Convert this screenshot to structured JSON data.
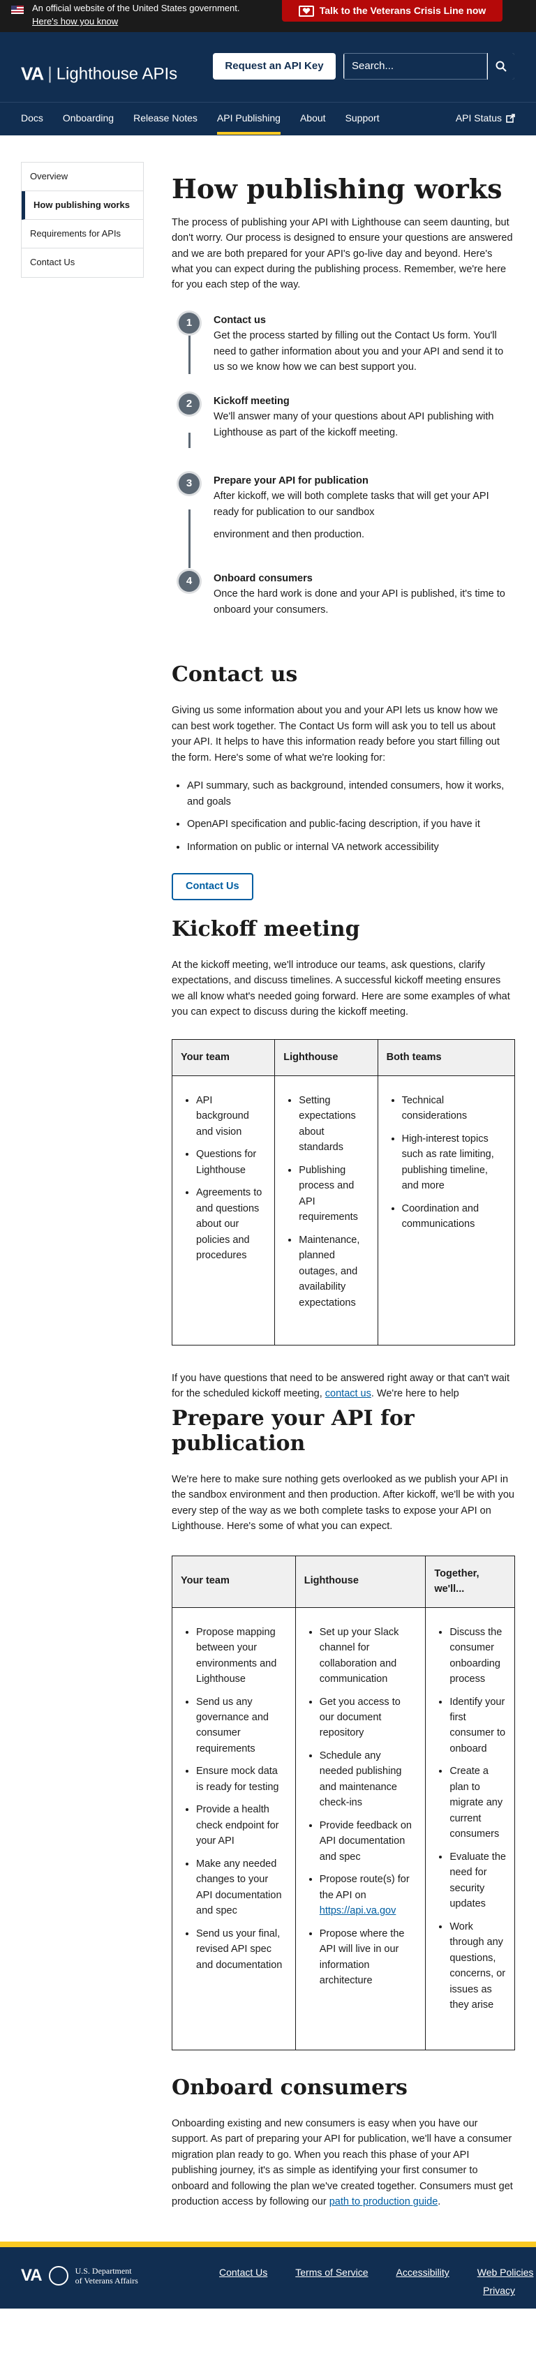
{
  "gov_banner": {
    "text": "An official website of the United States government.",
    "link": "Here's how you know",
    "crisis_button": "Talk to the Veterans Crisis Line now"
  },
  "header": {
    "brand_va": "VA",
    "brand_name": "Lighthouse APIs",
    "request_key": "Request an API Key",
    "search_placeholder": "Search..."
  },
  "nav": {
    "items": [
      "Docs",
      "Onboarding",
      "Release Notes",
      "API Publishing",
      "About",
      "Support"
    ],
    "active": "API Publishing",
    "status": "API Status"
  },
  "sidenav": {
    "items": [
      "Overview",
      "How publishing works",
      "Requirements for APIs",
      "Contact Us"
    ],
    "current": "How publishing works"
  },
  "intro": {
    "title": "How publishing works",
    "text": "The process of publishing your API with Lighthouse can seem daunting, but don't worry. Our process is designed to ensure your questions are answered and we are both prepared for your API's go-live day and beyond. Here's what you can expect during the publishing process. Remember, we're here for you each step of the way."
  },
  "steps": [
    {
      "num": "1",
      "title": "Contact us",
      "text": "Get the process started by filling out the Contact Us form. You'll need to gather information about you and your API and send it to us so we know how we can best support you."
    },
    {
      "num": "2",
      "title": "Kickoff meeting",
      "text": "We'll answer many of your questions about API publishing with Lighthouse as part of the kickoff meeting."
    },
    {
      "num": "3",
      "title": "Prepare your API for publication",
      "text": "After kickoff, we will both complete tasks that will get your API ready for publication to our sandbox",
      "text2": "environment and then production."
    },
    {
      "num": "4",
      "title": "Onboard consumers",
      "text": "Once the hard work is done and your API is published, it's time to onboard your consumers."
    }
  ],
  "contact": {
    "title": "Contact us",
    "text": "Giving us some information about you and your API lets us know how we can best work together. The Contact Us form will ask you to tell us about your API. It helps to have this information ready before you start filling out the form. Here's some of what we're looking for:",
    "bullets": [
      "API summary, such as background, intended consumers, how it works, and goals",
      "OpenAPI specification and public-facing description, if you have it",
      "Information on public or internal VA network accessibility"
    ],
    "button": "Contact Us"
  },
  "kickoff": {
    "title": "Kickoff meeting",
    "text": "At the kickoff meeting, we'll introduce our teams, ask questions, clarify expectations, and discuss timelines. A successful kickoff meeting ensures we all know what's needed going forward. Here are some examples of what you can expect to discuss during the kickoff meeting.",
    "headers": [
      "Your team",
      "Lighthouse",
      "Both teams"
    ],
    "columns": [
      [
        "API background and vision",
        "Questions for Lighthouse",
        "Agreements to and questions about our policies and procedures"
      ],
      [
        "Setting expectations about standards",
        "Publishing process and API requirements",
        "Maintenance, planned outages, and availability expectations"
      ],
      [
        "Technical considerations",
        "High-interest topics such as rate limiting, publishing timeline, and more",
        "Coordination and communications"
      ]
    ],
    "after_pre": "If you have questions that need to be answered right away or that can't wait for the scheduled kickoff meeting, ",
    "after_link": "contact us",
    "after_post": ". We're here to help"
  },
  "prepare": {
    "title": "Prepare your API for publication",
    "text": "We're here to make sure nothing gets overlooked as we publish your API in the sandbox environment and then production. After kickoff, we'll be with you every step of the way as we both complete tasks to expose your API on Lighthouse. Here's some of what you can expect.",
    "headers": [
      "Your team",
      "Lighthouse",
      "Together, we'll..."
    ],
    "col1": [
      "Propose mapping between your environments and Lighthouse",
      "Send us any governance and consumer requirements",
      "Ensure mock data is ready for testing",
      "Provide a health check endpoint for your API",
      "Make any needed changes to your API documentation and spec",
      "Send us your final, revised API spec and documentation"
    ],
    "col2_a": [
      "Set up your Slack channel for collaboration and communication",
      "Get you access to our document repository",
      "Schedule any needed publishing and maintenance check-ins",
      "Provide feedback on API documentation and spec"
    ],
    "col2_route_text": "Propose route(s) for the API on ",
    "col2_route_link": "https://api.va.gov",
    "col2_b": [
      "Propose where the API will live in our information architecture"
    ],
    "col3": [
      "Discuss the consumer onboarding process",
      "Identify your first consumer to onboard",
      "Create a plan to migrate any current consumers",
      "Evaluate the need for security updates",
      "Work through any questions, concerns, or issues as they arise"
    ]
  },
  "onboard": {
    "title": "Onboard consumers",
    "text": "Onboarding existing and new consumers is easy when you have our support. As part of preparing your API for publication, we'll have a consumer migration plan ready to go. When you reach this phase of your API publishing journey, it's as simple as identifying your first consumer to onboard and following the plan we've created together. Consumers must get production access by following our ",
    "link": "path to production guide",
    "end": "."
  },
  "footer": {
    "va": "VA",
    "dept_line1": "U.S. Department",
    "dept_line2": "of Veterans Affairs",
    "links": [
      "Contact Us",
      "Terms of Service",
      "Accessibility",
      "Web Policies"
    ],
    "privacy": "Privacy"
  },
  "colors": {
    "navy": "#112e51",
    "gold": "#fac922",
    "crisis": "#b50909",
    "link": "#005ea2"
  }
}
